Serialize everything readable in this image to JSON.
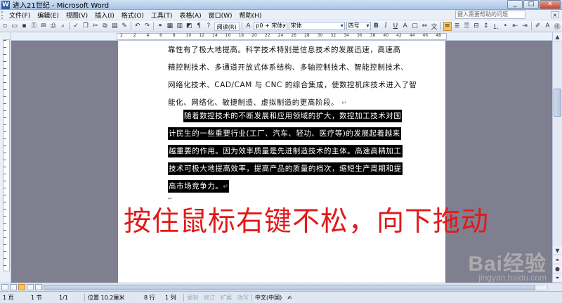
{
  "window": {
    "title": "进入21世纪 - Microsoft Word",
    "minimize": "_",
    "maximize": "□",
    "close": "✕"
  },
  "menu": {
    "items": [
      "文件(F)",
      "编辑(E)",
      "视图(V)",
      "插入(I)",
      "格式(O)",
      "工具(T)",
      "表格(A)",
      "窗口(W)",
      "帮助(H)"
    ],
    "help_placeholder": "键入需要帮助的问题",
    "doc_close": "×"
  },
  "toolbar": {
    "reading_label": "阅读(R)",
    "style_value": "p0 + 宋体,",
    "font_value": "宋体",
    "size_value": "四号",
    "bold": "B",
    "italic": "I",
    "underline": "U",
    "highlight_color": "#f7c566"
  },
  "ruler": {
    "numbers": [
      "2",
      "2",
      "4",
      "6",
      "8",
      "10",
      "12",
      "14",
      "16",
      "18",
      "20",
      "22",
      "24",
      "26",
      "28",
      "30",
      "32",
      "34",
      "36",
      "38",
      "40",
      "42",
      "44",
      "46",
      "48"
    ]
  },
  "document": {
    "lines": [
      "靠性有了极大地提高。科学技术特别是信息技术的发展迅速，高速高",
      "精控制技术、多通道开放式体系结构、多轴控制技术、智能控制技术、",
      "网络化技术、CAD/CAM 与 CNC 的综合集成，使数控机床技术进入了智",
      "能化、网络化、敏捷制造、虚拟制造的更高阶段。"
    ],
    "selected_lines": [
      "随着数控技术的不断发展和应用领域的扩大，数控加工技术对国",
      "计民生的一些重要行业(工厂、汽车、轻功、医疗等)的发展起着越来",
      "越重要的作用。因为效率质量是先进制造技术的主体。高速高精加工",
      "技术可极大地提高效率，提高产品的质量的档次，缩短生产周期和提",
      "高市场竞争力。"
    ],
    "para_mark": "↵",
    "cursor_mark": "↵"
  },
  "annotation": {
    "text": "按住鼠标右键不松，向下拖动",
    "color": "#e01a1a"
  },
  "watermark": {
    "logo": "Bai经验",
    "url": "jingyan.baidu.com"
  },
  "status": {
    "page": "1 页",
    "section": "1 节",
    "page_count": "1/1",
    "position": "位置 10.2厘米",
    "line": "8 行",
    "column": "1 列",
    "rec": "录制",
    "trk": "修订",
    "ext": "扩展",
    "ovr": "改写",
    "language": "中文(中国)"
  }
}
